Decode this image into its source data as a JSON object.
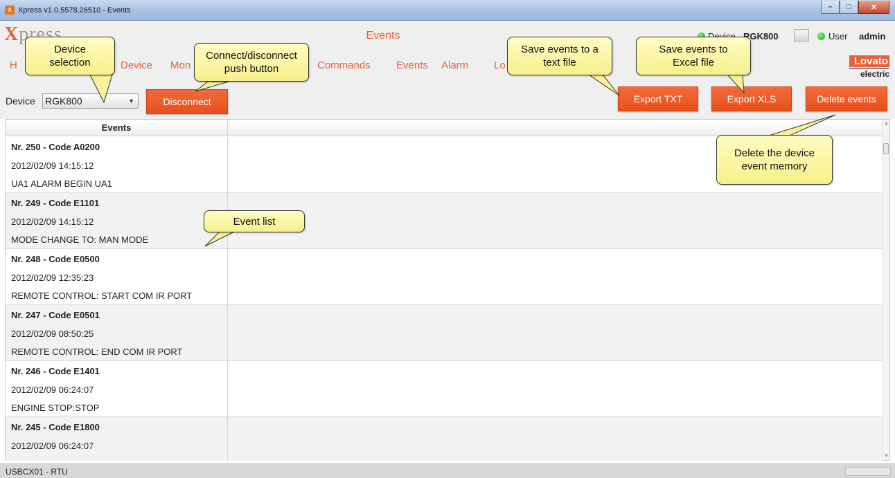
{
  "window": {
    "title": "Xpress v1.0.5578.26510 - Events",
    "app_icon_text": "X",
    "min": "–",
    "max": "□",
    "close": "✕"
  },
  "header": {
    "logo_first": "X",
    "logo_rest": "press",
    "page_title": "Events",
    "device_label": "Device",
    "device_value": "RGK800",
    "user_label": "User",
    "user_value": "admin"
  },
  "menu": {
    "items": [
      "H",
      "Device",
      "Mon",
      "Commands",
      "Events",
      "Alarm",
      "Lo"
    ]
  },
  "brand": {
    "top": "Lovato",
    "bottom": "electric"
  },
  "toolbar": {
    "device_label": "Device",
    "device_selected": "RGK800",
    "disconnect": "Disconnect",
    "export_txt": "Export TXT",
    "export_xls": "Export XLS",
    "delete_events": "Delete events"
  },
  "table": {
    "column_header": "Events",
    "rows": [
      {
        "title": "Nr. 250 - Code A0200",
        "datetime": "2012/02/09 14:15:12",
        "description": "UA1 ALARM BEGIN UA1"
      },
      {
        "title": "Nr. 249 - Code E1101",
        "datetime": "2012/02/09 14:15:12",
        "description": "MODE CHANGE TO: MAN MODE"
      },
      {
        "title": "Nr. 248 - Code E0500",
        "datetime": "2012/02/09 12:35:23",
        "description": "REMOTE CONTROL: START COM IR PORT"
      },
      {
        "title": "Nr. 247 - Code E0501",
        "datetime": "2012/02/09 08:50:25",
        "description": "REMOTE CONTROL: END COM IR PORT"
      },
      {
        "title": "Nr. 246 - Code E1401",
        "datetime": "2012/02/09 06:24:07",
        "description": "ENGINE STOP:STOP"
      },
      {
        "title": "Nr. 245 - Code E1800",
        "datetime": "2012/02/09 06:24:07",
        "description": ""
      }
    ]
  },
  "statusbar": {
    "text": "USBCX01 - RTU"
  },
  "callouts": {
    "device_selection": [
      "Device",
      "selection"
    ],
    "connect": [
      "Connect/disconnect",
      "push button"
    ],
    "save_txt": [
      "Save events to a",
      "text file"
    ],
    "save_xls": [
      "Save events to",
      "Excel file"
    ],
    "delete": [
      "Delete the device",
      "event memory"
    ],
    "event_list": [
      "Event list"
    ]
  },
  "colors": {
    "accent": "#e8603a",
    "callout": "#f8f29a",
    "status_ok": "#22aa22"
  }
}
